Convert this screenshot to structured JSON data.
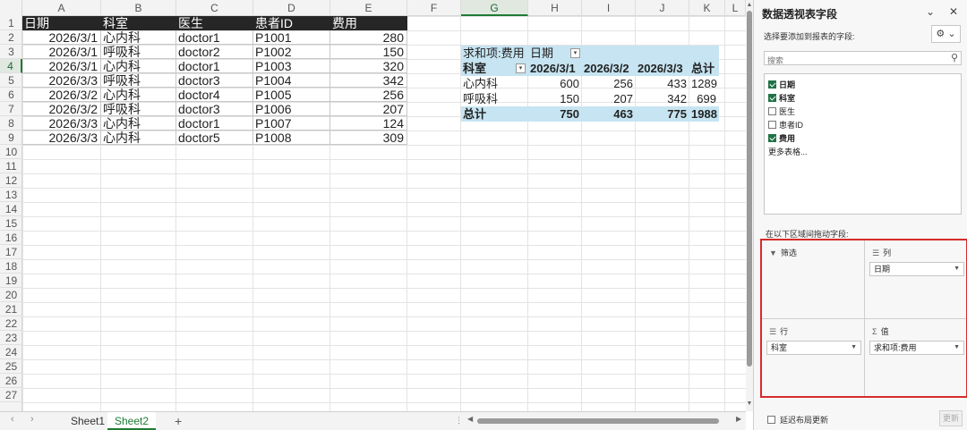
{
  "sheet": {
    "columns": [
      "A",
      "B",
      "C",
      "D",
      "E",
      "F",
      "G",
      "H",
      "I",
      "J",
      "K",
      "L"
    ],
    "selected_column": "G",
    "rows": [
      "1",
      "2",
      "3",
      "4",
      "5",
      "6",
      "7",
      "8",
      "9",
      "10",
      "11",
      "12",
      "13",
      "14",
      "15",
      "16",
      "17",
      "18",
      "19",
      "20",
      "21",
      "22",
      "23",
      "24",
      "25",
      "26",
      "27"
    ],
    "selected_row": "4",
    "table": {
      "headers": [
        "日期",
        "科室",
        "医生",
        "患者ID",
        "费用"
      ],
      "records": [
        [
          "2026/3/1",
          "心内科",
          "doctor1",
          "P1001",
          "280"
        ],
        [
          "2026/3/1",
          "呼吸科",
          "doctor2",
          "P1002",
          "150"
        ],
        [
          "2026/3/1",
          "心内科",
          "doctor1",
          "P1003",
          "320"
        ],
        [
          "2026/3/3",
          "呼吸科",
          "doctor3",
          "P1004",
          "342"
        ],
        [
          "2026/3/2",
          "心内科",
          "doctor4",
          "P1005",
          "256"
        ],
        [
          "2026/3/2",
          "呼吸科",
          "doctor3",
          "P1006",
          "207"
        ],
        [
          "2026/3/3",
          "心内科",
          "doctor1",
          "P1007",
          "124"
        ],
        [
          "2026/3/3",
          "心内科",
          "doctor5",
          "P1008",
          "309"
        ]
      ]
    },
    "pivot": {
      "value_label": "求和项:费用",
      "column_label": "日期",
      "row_label": "科室",
      "dates": [
        "2026/3/1",
        "2026/3/2",
        "2026/3/3"
      ],
      "total_label": "总计",
      "rows": [
        {
          "name": "心内科",
          "values": [
            "600",
            "256",
            "433"
          ],
          "total": "1289"
        },
        {
          "name": "呼吸科",
          "values": [
            "150",
            "207",
            "342"
          ],
          "total": "699"
        }
      ],
      "grand": {
        "name": "总计",
        "values": [
          "750",
          "463",
          "775"
        ],
        "total": "1988"
      }
    }
  },
  "tabs": [
    "Sheet1",
    "Sheet2"
  ],
  "active_tab": "Sheet2",
  "add_tab_glyph": "+",
  "panel": {
    "title": "数据透视表字段",
    "subtitle": "选择要添加到报表的字段:",
    "search_placeholder": "搜索",
    "fields": [
      {
        "name": "日期",
        "checked": true
      },
      {
        "name": "科室",
        "checked": true
      },
      {
        "name": "医生",
        "checked": false
      },
      {
        "name": "患者ID",
        "checked": false
      },
      {
        "name": "费用",
        "checked": true
      }
    ],
    "more_tables": "更多表格...",
    "drag_hint": "在以下区域间拖动字段:",
    "areas": {
      "filter": {
        "label": "筛选",
        "icon": "filter-icon",
        "items": []
      },
      "columns": {
        "label": "列",
        "icon": "columns-icon",
        "items": [
          "日期"
        ]
      },
      "rows": {
        "label": "行",
        "icon": "rows-icon",
        "items": [
          "科室"
        ]
      },
      "values": {
        "label": "值",
        "icon": "sigma-icon",
        "items": [
          "求和项:费用"
        ]
      }
    },
    "defer_label": "延迟布局更新",
    "update_label": "更新"
  },
  "colors": {
    "header_black": "#262626",
    "pivot_blue": "#c6e4f1",
    "accent_green": "#1e7b34",
    "highlight_red": "#d62b2b"
  }
}
